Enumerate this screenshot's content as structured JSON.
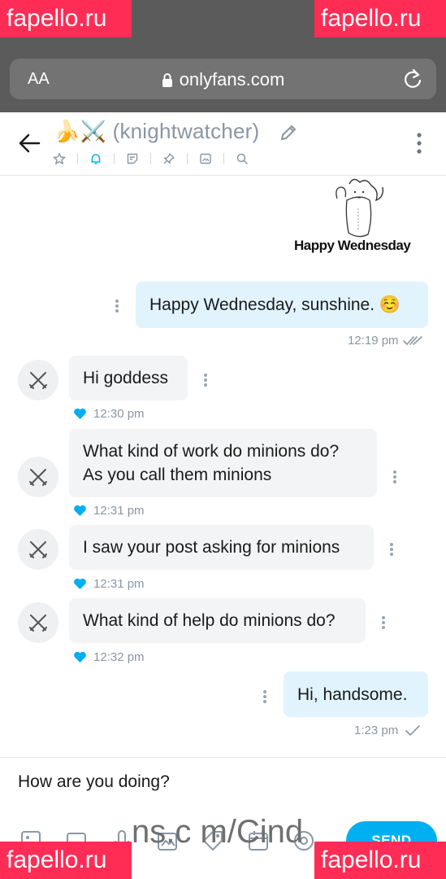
{
  "browser": {
    "text_size_label": "AA",
    "url": "onlyfans.com"
  },
  "watermark": {
    "text": "fapello.ru",
    "color": "#ff2d55"
  },
  "header": {
    "contact_emoji": "🍌⚔️",
    "contact_name": "(knightwatcher)",
    "actions": [
      "star-icon",
      "bell-icon",
      "note-icon",
      "pin-icon",
      "media-icon",
      "search-icon"
    ]
  },
  "sticker": {
    "caption": "Happy Wednesday"
  },
  "messages": [
    {
      "direction": "out",
      "text": "Happy Wednesday, sunshine. ☺️",
      "time": "12:19 pm",
      "status": "read"
    },
    {
      "direction": "in",
      "text": "Hi goddess",
      "time": "12:30 pm",
      "liked": true
    },
    {
      "direction": "in",
      "text": "What kind of work do minions do? As you call them minions",
      "line1": "What kind of work do minions do?",
      "line2": "As you call them minions",
      "time": "12:31 pm",
      "liked": true
    },
    {
      "direction": "in",
      "text": "I saw your post asking for minions",
      "time": "12:31 pm",
      "liked": true
    },
    {
      "direction": "in",
      "text": "What kind of help do minions do?",
      "time": "12:32 pm",
      "liked": true
    },
    {
      "direction": "out",
      "text": "Hi, handsome.",
      "time": "1:23 pm",
      "status": "sent"
    }
  ],
  "composer": {
    "value": "How are you doing?",
    "send_label": "SEND",
    "overlay_text": "ns.c m/Cind"
  },
  "colors": {
    "accent": "#00aff0",
    "outgoing_bubble": "#e1f4fd",
    "incoming_bubble": "#f2f4f5",
    "muted": "#8a96a3"
  }
}
